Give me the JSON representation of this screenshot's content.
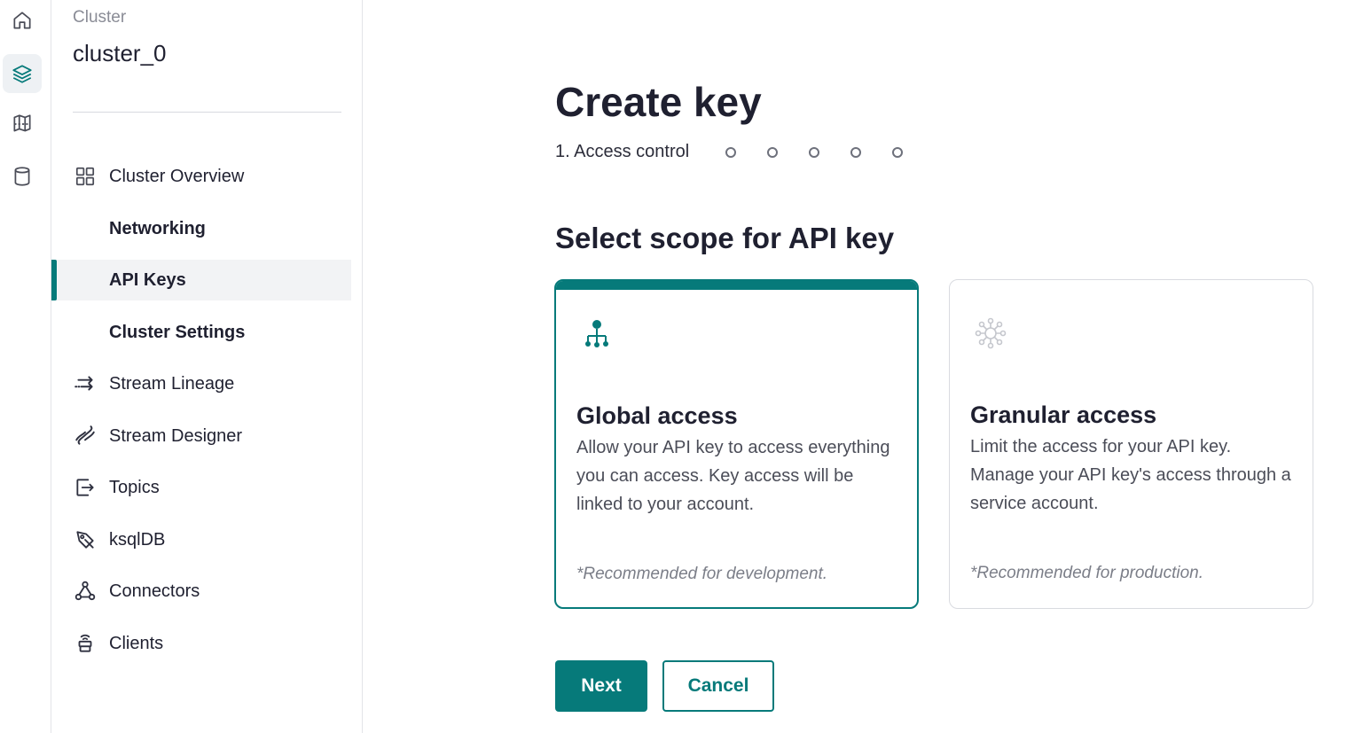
{
  "rail": {
    "items": [
      {
        "icon": "home-icon"
      },
      {
        "icon": "layers-icon",
        "active": true
      },
      {
        "icon": "map-icon"
      },
      {
        "icon": "database-icon"
      }
    ]
  },
  "sidebar": {
    "cluster_label": "Cluster",
    "cluster_name": "cluster_0",
    "items": [
      {
        "label": "Cluster Overview",
        "icon": "grid-icon"
      },
      {
        "label": "Networking"
      },
      {
        "label": "API Keys",
        "active": true
      },
      {
        "label": "Cluster Settings"
      },
      {
        "label": "Stream Lineage",
        "icon": "stream-lineage-icon"
      },
      {
        "label": "Stream Designer",
        "icon": "stream-designer-icon"
      },
      {
        "label": "Topics",
        "icon": "topics-icon"
      },
      {
        "label": "ksqlDB",
        "icon": "ksqldb-icon"
      },
      {
        "label": "Connectors",
        "icon": "connectors-icon"
      },
      {
        "label": "Clients",
        "icon": "clients-icon"
      }
    ]
  },
  "main": {
    "title": "Create key",
    "step_label": "1. Access control",
    "step_count": 5,
    "section_title": "Select scope for API key",
    "cards": [
      {
        "title": "Global access",
        "description": "Allow your API key to access everything you can access. Key access will be linked to your account.",
        "note": "*Recommended for development.",
        "selected": true
      },
      {
        "title": "Granular access",
        "description": "Limit the access for your API key. Manage your API key's access through a service account.",
        "note": "*Recommended for production.",
        "selected": false
      }
    ],
    "buttons": {
      "next": "Next",
      "cancel": "Cancel"
    }
  },
  "colors": {
    "accent": "#067a7a",
    "text": "#1f2030",
    "muted": "#7b7e88"
  }
}
